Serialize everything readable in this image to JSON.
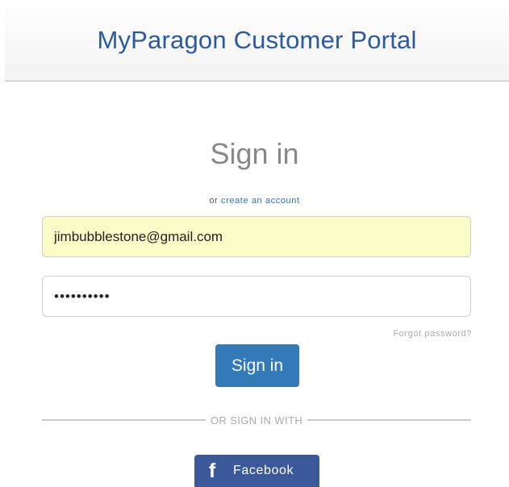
{
  "header": {
    "title": "MyParagon Customer Portal"
  },
  "signin": {
    "heading": "Sign in",
    "or_text": "or",
    "create_account_link": "create an account",
    "email_value": "jimbubblestone@gmail.com",
    "password_value": "••••••••••",
    "forgot_password": "Forgot password?",
    "submit_label": "Sign in",
    "divider_text": "OR SIGN IN WITH",
    "facebook_icon": "f",
    "facebook_label": "Facebook"
  },
  "colors": {
    "title": "#2c5aa0",
    "primary_button": "#337ab7",
    "facebook": "#3b5998",
    "autofill_background": "#fafcc8",
    "link": "#2a74b8"
  }
}
